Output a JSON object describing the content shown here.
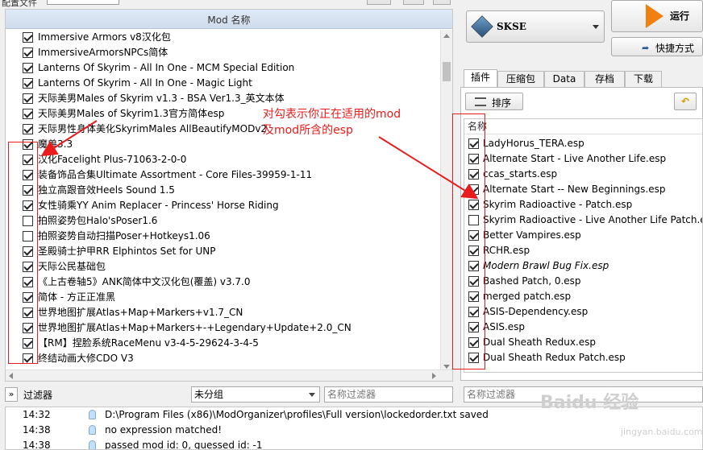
{
  "topbar": {
    "label": "配置文件"
  },
  "mods": {
    "header": "Mod 名称",
    "rows": [
      {
        "label": "Immersive Armors v8汉化包",
        "checked": true
      },
      {
        "label": "ImmersiveArmorsNPCs简体",
        "checked": true
      },
      {
        "label": "Lanterns Of Skyrim - All In One - MCM Special Edition",
        "checked": true
      },
      {
        "label": "Lanterns Of Skyrim - All In One - Magic Light",
        "checked": true
      },
      {
        "label": "天际美男Males of Skyrim v1.3 - BSA Ver1.3_英文本体",
        "checked": true
      },
      {
        "label": "天际美男Males of Skyrim1.3官方简体esp",
        "checked": true
      },
      {
        "label": "天际男性身体美化SkyrimMales AllBeautifyMODv2",
        "checked": true
      },
      {
        "label": "魔兽3.3",
        "checked": true
      },
      {
        "label": "汉化Facelight Plus-71063-2-0-0",
        "checked": true
      },
      {
        "label": "装备饰品合集Ultimate Assortment - Core Files-39959-1-11",
        "checked": true
      },
      {
        "label": "独立高跟音效Heels Sound 1.5",
        "checked": true
      },
      {
        "label": "女性骑乘YY Anim Replacer - Princess' Horse Riding",
        "checked": true
      },
      {
        "label": "拍照姿势包Halo'sPoser1.6",
        "checked": false
      },
      {
        "label": "拍照姿势自动扫描Poser+Hotkeys1.06",
        "checked": false
      },
      {
        "label": "圣殿骑士护甲RR Elphintos Set for UNP",
        "checked": true
      },
      {
        "label": "天际公民基础包",
        "checked": true
      },
      {
        "label": "《上古卷轴5》ANK简体中文汉化包(覆盖) v3.7.0",
        "checked": true
      },
      {
        "label": "简体 - 方正正准黑",
        "checked": true
      },
      {
        "label": "世界地图扩展Atlas+Map+Markers+v1.7_CN",
        "checked": true
      },
      {
        "label": "世界地图扩展Atlas+Map+Markers+-+Legendary+Update+2.0_CN",
        "checked": true
      },
      {
        "label": "【RM】捏脸系统RaceMenu v3-4-5-29624-3-4-5",
        "checked": true
      },
      {
        "label": "终结动画大修CDO V3",
        "checked": true
      }
    ]
  },
  "filterbar": {
    "toggle": "»",
    "label": "过滤器",
    "group_value": "未分组",
    "name_filter_placeholder": "名称过滤器"
  },
  "log": [
    {
      "time": "14:32",
      "message": "D:\\Program Files (x86)\\ModOrganizer\\profiles\\Full version\\lockedorder.txt saved"
    },
    {
      "time": "14:38",
      "message": "no expression matched!"
    },
    {
      "time": "14:38",
      "message": "passed mod id: 0, guessed id: -1"
    }
  ],
  "launcher": {
    "executable": "SKSE",
    "run_label": "运行",
    "shortcut_label": "快捷方式"
  },
  "tabs": [
    "插件",
    "压缩包",
    "Data",
    "存档",
    "下载"
  ],
  "plugins": {
    "sort_label": "排序",
    "header": "名称",
    "rows": [
      {
        "label": "LadyHorus_TERA.esp",
        "checked": true,
        "italic": false
      },
      {
        "label": "Alternate Start - Live Another Life.esp",
        "checked": true,
        "italic": false
      },
      {
        "label": "ccas_starts.esp",
        "checked": true,
        "italic": false
      },
      {
        "label": "Alternate Start -- New Beginnings.esp",
        "checked": true,
        "italic": false
      },
      {
        "label": "Skyrim Radioactive - Patch.esp",
        "checked": true,
        "italic": false
      },
      {
        "label": "Skyrim Radioactive - Live Another Life Patch.esp",
        "checked": false,
        "italic": false
      },
      {
        "label": "Better Vampires.esp",
        "checked": true,
        "italic": false
      },
      {
        "label": "RCHR.esp",
        "checked": true,
        "italic": false
      },
      {
        "label": "Modern Brawl Bug Fix.esp",
        "checked": true,
        "italic": true
      },
      {
        "label": "Bashed Patch, 0.esp",
        "checked": true,
        "italic": false
      },
      {
        "label": "merged patch.esp",
        "checked": true,
        "italic": false
      },
      {
        "label": "ASIS-Dependency.esp",
        "checked": true,
        "italic": false
      },
      {
        "label": "ASIS.esp",
        "checked": true,
        "italic": false
      },
      {
        "label": "Dual Sheath Redux.esp",
        "checked": true,
        "italic": false
      },
      {
        "label": "Dual Sheath Redux Patch.esp",
        "checked": true,
        "italic": false
      }
    ],
    "name_filter_placeholder": "名称过滤器"
  },
  "annotation": {
    "line1": "对勾表示你正在适用的mod",
    "line2": "及mod所含的esp"
  },
  "watermark": {
    "text": "Baidu 经验",
    "url": "jingyan.baidu.com"
  }
}
